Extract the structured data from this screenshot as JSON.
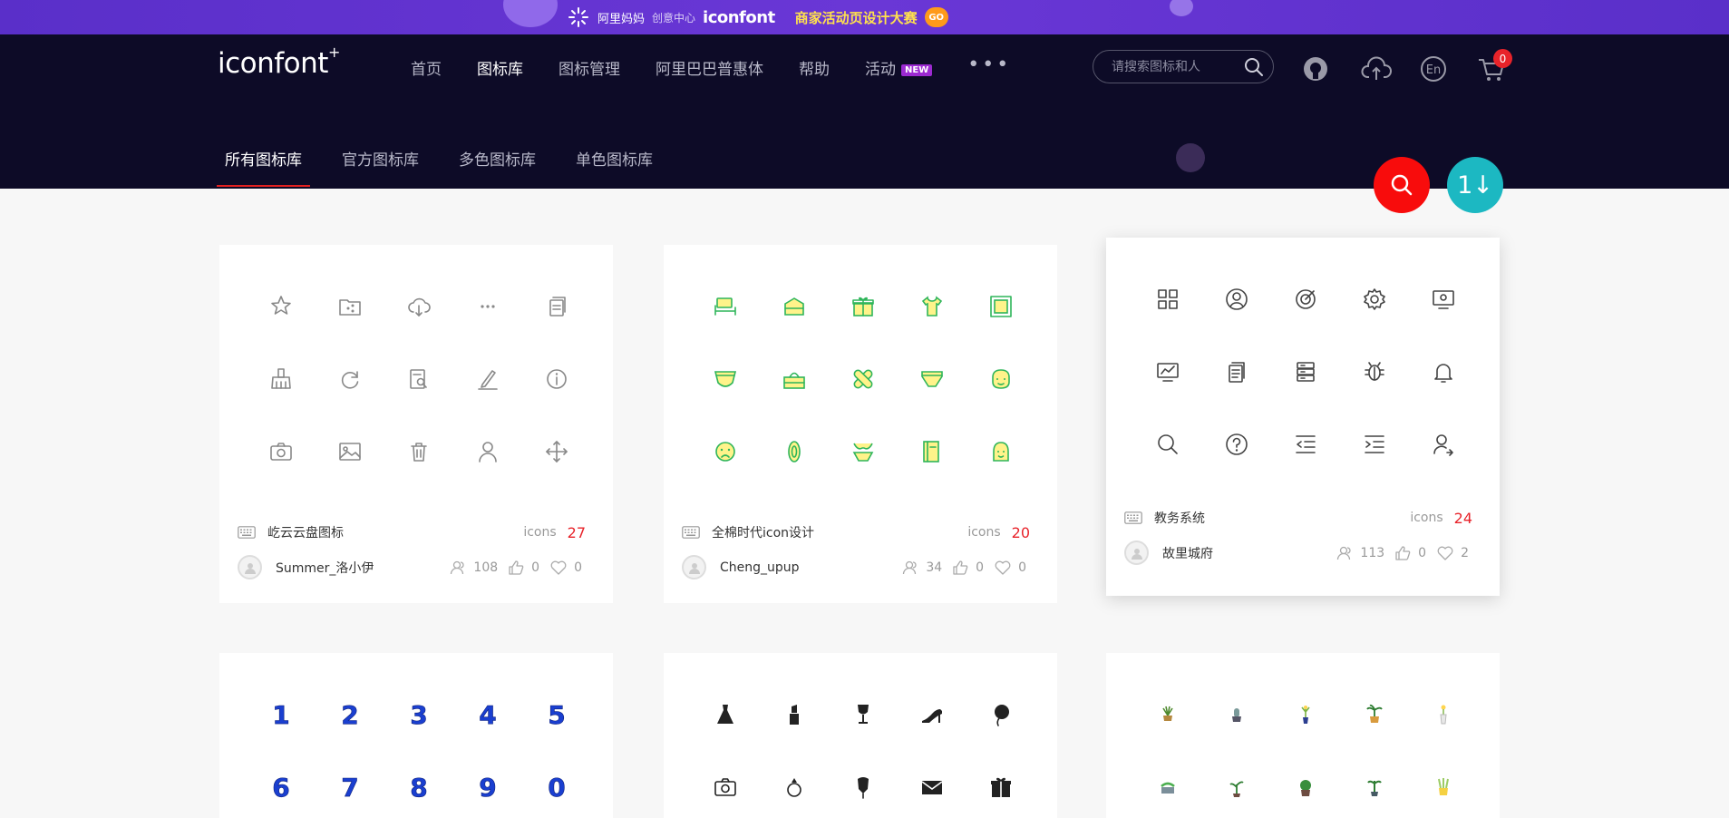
{
  "banner": {
    "brand": "阿里妈妈",
    "brand_sub": "创意中心",
    "logo_text": "iconfont",
    "promo_text": "商家活动页设计大赛",
    "go_label": "GO"
  },
  "header": {
    "logo_text": "iconfont",
    "logo_plus": "+",
    "nav": [
      {
        "label": "首页"
      },
      {
        "label": "图标库"
      },
      {
        "label": "图标管理"
      },
      {
        "label": "阿里巴巴普惠体"
      },
      {
        "label": "帮助"
      },
      {
        "label": "活动"
      }
    ],
    "new_badge": "NEW",
    "more_label": "•••",
    "search_placeholder": "请搜索图标和人",
    "cart_count": "0"
  },
  "subtabs": [
    {
      "label": "所有图标库"
    },
    {
      "label": "官方图标库"
    },
    {
      "label": "多色图标库"
    },
    {
      "label": "单色图标库"
    }
  ],
  "fab": {
    "sort_label": "1↓"
  },
  "cards": [
    {
      "name": "屹云云盘图标",
      "count_label": "icons",
      "count": "27",
      "user": "Summer_洛小伊",
      "members": "108",
      "likes": "0",
      "favorites": "0",
      "icon_color": "#888888",
      "icons": [
        "star-icon",
        "folder-share-icon",
        "cloud-download-icon",
        "more-icon",
        "copy-icon",
        "broom-icon",
        "refresh-icon",
        "doc-search-icon",
        "pen-icon",
        "info-icon",
        "camera-icon",
        "image-icon",
        "trash-icon",
        "user-icon",
        "move-icon"
      ]
    },
    {
      "name": "全棉时代icon设计",
      "count_label": "icons",
      "count": "20",
      "user": "Cheng_upup",
      "members": "34",
      "likes": "0",
      "favorites": "0",
      "icon_color": "#2fb55a",
      "icons": [
        "bed-icon",
        "towel-icon",
        "gift-box-icon",
        "tshirt-icon",
        "frame-icon",
        "diaper-icon",
        "tissue-box-icon",
        "bandage-icon",
        "underwear-icon",
        "face-icon",
        "sad-face-icon",
        "sanitary-pad-icon",
        "bikini-icon",
        "book-icon",
        "woman-face-icon"
      ]
    },
    {
      "name": "教务系统",
      "count_label": "icons",
      "count": "24",
      "user": "故里城府",
      "members": "113",
      "likes": "0",
      "favorites": "2",
      "icon_color": "#444444",
      "icons": [
        "grid-icon",
        "user-circle-icon",
        "target-icon",
        "gear-icon",
        "monitor-icon",
        "chart-icon",
        "documents-icon",
        "server-icon",
        "bug-icon",
        "bell-icon",
        "search-icon",
        "question-icon",
        "indent-left-icon",
        "indent-right-icon",
        "user-edit-icon"
      ]
    },
    {
      "name": "",
      "count_label": "",
      "count": "",
      "user": "",
      "icon_color": "#1a3fd0",
      "digits": [
        "1",
        "2",
        "3",
        "4",
        "5",
        "6",
        "7",
        "8",
        "9",
        "0"
      ]
    },
    {
      "name": "",
      "count_label": "",
      "count": "",
      "user": "",
      "icon_color": "#222222",
      "icons": [
        "dress-icon",
        "lipstick-icon",
        "wine-glass-icon",
        "high-heel-icon",
        "balloon-icon",
        "camera-icon",
        "ring-icon",
        "diamond-icon",
        "envelope-icon",
        "gift-icon"
      ]
    },
    {
      "name": "",
      "count_label": "",
      "count": "",
      "user": "",
      "icon_color": "#5b9a3c",
      "icons": [
        "plant-pot-icon",
        "cactus-icon",
        "flower-vase-icon",
        "palm-pot-icon",
        "bottle-flower-icon",
        "succulent-icon",
        "sprout-icon",
        "bush-pot-icon",
        "tree-pot-icon",
        "yellow-plant-icon"
      ]
    }
  ]
}
